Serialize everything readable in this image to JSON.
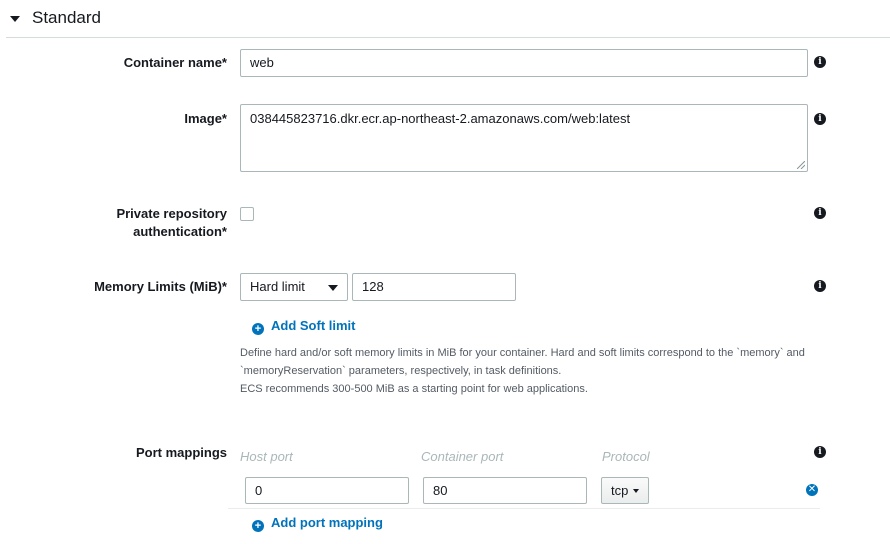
{
  "section": {
    "title": "Standard",
    "caret_icon": "caret-down-icon"
  },
  "container_name": {
    "label": "Container name*",
    "value": "web"
  },
  "image": {
    "label": "Image*",
    "value": "038445823716.dkr.ecr.ap-northeast-2.amazonaws.com/web:latest"
  },
  "private_repo": {
    "label_line1": "Private repository",
    "label_line2": "authentication*",
    "checked": false
  },
  "memory": {
    "label": "Memory Limits (MiB)*",
    "limit_type": "Hard limit",
    "value": "128",
    "add_soft_limit": "Add Soft limit",
    "help_line1": "Define hard and/or soft memory limits in MiB for your container. Hard and soft limits correspond to the `memory` and",
    "help_line2": "`memoryReservation` parameters, respectively, in task definitions.",
    "help_line3": "ECS recommends 300-500 MiB as a starting point for web applications."
  },
  "port_mappings": {
    "label": "Port mappings",
    "headers": {
      "host_port": "Host port",
      "container_port": "Container port",
      "protocol": "Protocol"
    },
    "rows": [
      {
        "host_port": "0",
        "container_port": "80",
        "protocol": "tcp"
      }
    ],
    "add_label": "Add port mapping"
  },
  "icons": {
    "info": "info-icon",
    "add": "plus-circle-icon",
    "remove": "close-circle-icon"
  },
  "colors": {
    "link": "#0073bb",
    "text": "#16191f",
    "border": "#aab7b8",
    "muted": "#545b64"
  }
}
